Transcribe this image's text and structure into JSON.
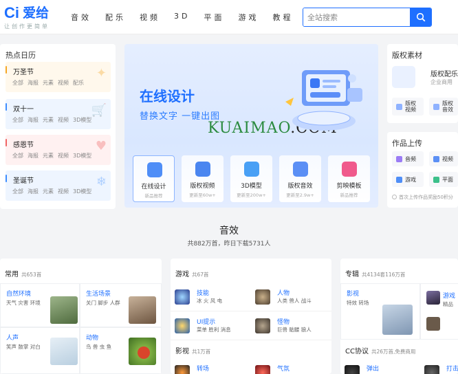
{
  "header": {
    "logo_text": "爱给",
    "slogan": "让创作更简单",
    "nav": [
      "音效",
      "配乐",
      "视频",
      "3D",
      "平面",
      "游戏",
      "教程"
    ],
    "search_placeholder": "全站搜索"
  },
  "hot": {
    "title": "热点日历",
    "items": [
      {
        "name": "万圣节",
        "tags": [
          "全部",
          "海报",
          "元素",
          "视频",
          "配乐"
        ],
        "color": "#f5a623",
        "bg": "#fff8ec"
      },
      {
        "name": "双十一",
        "tags": [
          "全部",
          "海报",
          "元素",
          "视频",
          "3D模型"
        ],
        "color": "#3b8cff",
        "bg": "#eef5ff"
      },
      {
        "name": "感恩节",
        "tags": [
          "全部",
          "海报",
          "元素",
          "视频",
          "3D模型"
        ],
        "color": "#f06363",
        "bg": "#fff1f1"
      },
      {
        "name": "圣诞节",
        "tags": [
          "全部",
          "海报",
          "元素",
          "视频",
          "3D模型"
        ],
        "color": "#3b8cff",
        "bg": "#eef5ff"
      }
    ]
  },
  "banner": {
    "title": "在线设计",
    "subtitle": "替换文字  一键出图",
    "watermark_a": "KUAIMAO",
    "watermark_b": ".COM",
    "items": [
      {
        "label": "在线设计",
        "sub": "新品推荐",
        "color": "#4f8ef7"
      },
      {
        "label": "版权视频",
        "sub": "更新至60w+",
        "color": "#4b86f0"
      },
      {
        "label": "3D模型",
        "sub": "更新至200w+",
        "color": "#49a0f5"
      },
      {
        "label": "版权音效",
        "sub": "更新至2.9w+",
        "color": "#5b8ff5"
      },
      {
        "label": "剪映模板",
        "sub": "新品推荐",
        "color": "#f05a8c"
      }
    ]
  },
  "copyright": {
    "title": "版权素材",
    "main_label": "版权配乐",
    "main_sub": "企业商用",
    "buttons": [
      "版权视频",
      "版权音效"
    ]
  },
  "upload": {
    "title": "作品上传",
    "buttons": [
      "音频",
      "视频",
      "游戏",
      "平面"
    ],
    "note": "首次上传作品奖励50积分"
  },
  "section": {
    "title": "音效",
    "subtitle": "共882万首，昨日下载5731人"
  },
  "col1": {
    "title": "常用",
    "count": "共653首",
    "items": [
      {
        "t": "自然环境",
        "s": "天气 灾害 环境",
        "thumb": "#6b8a5b"
      },
      {
        "t": "生活场景",
        "s": "关门 脚步 人群",
        "thumb": "#8a7058"
      },
      {
        "t": "人声",
        "s": "笑声 鼓掌 对白",
        "thumb": "#c9dbe8"
      },
      {
        "t": "动物",
        "s": "鸟 兽 虫 鱼",
        "thumb": "#6a9a3a"
      }
    ]
  },
  "col2": {
    "title": "游戏",
    "count": "共67首",
    "items": [
      {
        "t": "技能",
        "s": "冰 火 风 电",
        "icon": "#2b3f8f"
      },
      {
        "t": "人物",
        "s": "人类 兽人 战斗",
        "icon": "#6b5a44"
      },
      {
        "t": "UI提示",
        "s": "菜单 胜利 消息",
        "icon": "#2a5fa8"
      },
      {
        "t": "怪物",
        "s": "巨兽 骷髅 狼人",
        "icon": "#5a5148"
      }
    ],
    "title2": "影视",
    "count2": "共1万首",
    "items2": [
      {
        "t": "转场",
        "s": "",
        "icon": "#333"
      },
      {
        "t": "气氛",
        "s": "",
        "icon": "#a0282a"
      }
    ]
  },
  "col3": {
    "title": "专辑",
    "count": "共4134套116万首",
    "items": [
      {
        "t": "影视",
        "s": "特效 转场",
        "thumb": "#9fb2c9"
      },
      {
        "t": "游戏",
        "s": "精品",
        "thumb": "#443b55"
      }
    ],
    "title2": "CC协议",
    "count2": "共26万首,免费商用",
    "items2": [
      {
        "t": "弹出",
        "icon": "#222"
      },
      {
        "t": "打击",
        "icon": "#333"
      }
    ]
  }
}
